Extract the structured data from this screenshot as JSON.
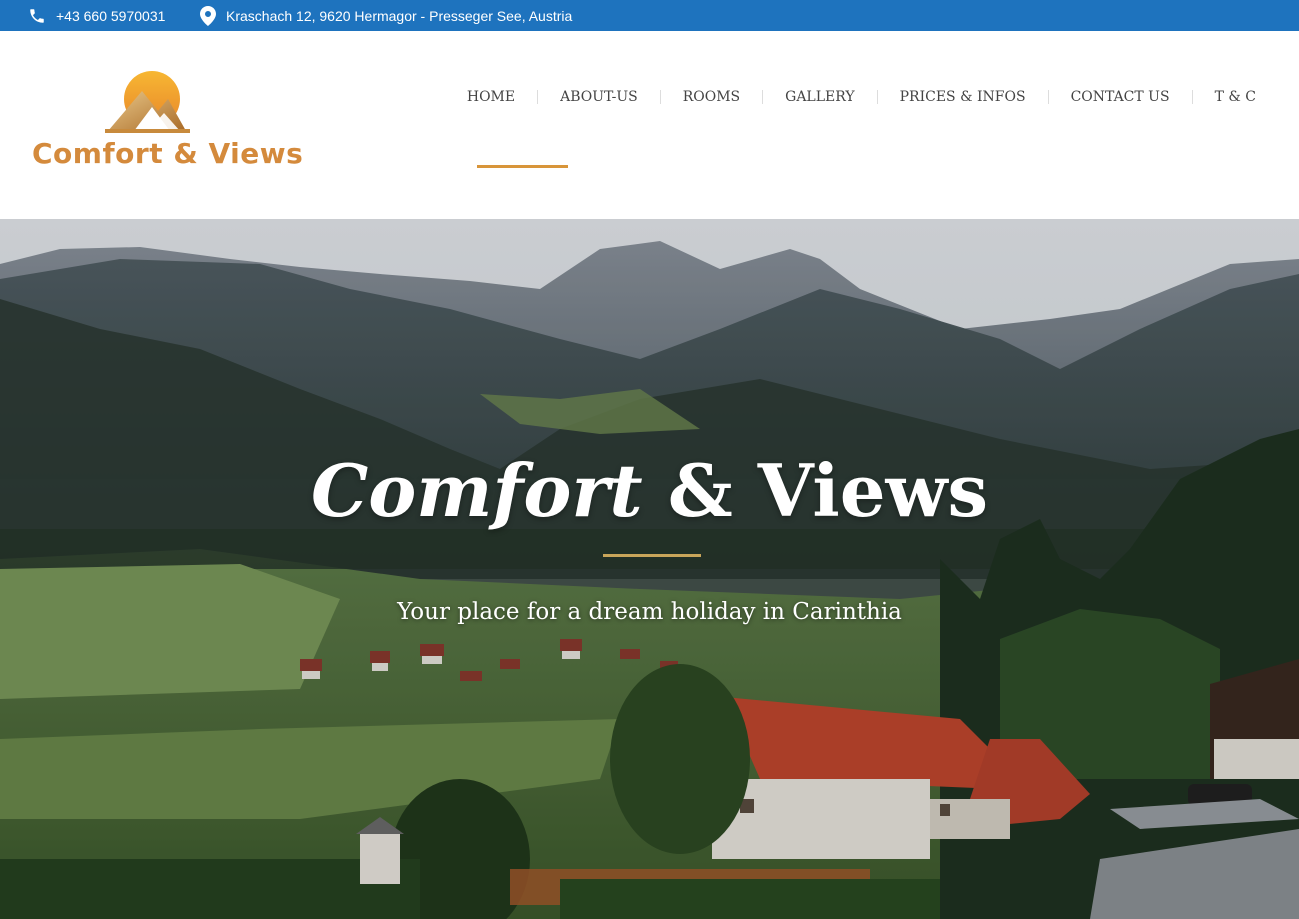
{
  "topbar": {
    "phone": "+43 660 5970031",
    "address": "Kraschach 12, 9620 Hermagor - Presseger See, Austria",
    "phone_icon": "phone-icon",
    "address_icon": "map-pin-icon",
    "bg_color": "#1e73be"
  },
  "logo": {
    "text": "Comfort & Views",
    "color": "#d48a3c"
  },
  "nav": {
    "items": [
      "HOME",
      "ABOUT-US",
      "ROOMS",
      "GALLERY",
      "PRICES & INFOS",
      "CONTACT US",
      "T & C"
    ],
    "active": "HOME",
    "active_color": "#d8953a"
  },
  "hero": {
    "title_italic": "Comfort",
    "title_rest": " & Views",
    "subtitle": "Your place for a dream holiday in Carinthia",
    "divider_color": "#c9a55a"
  }
}
